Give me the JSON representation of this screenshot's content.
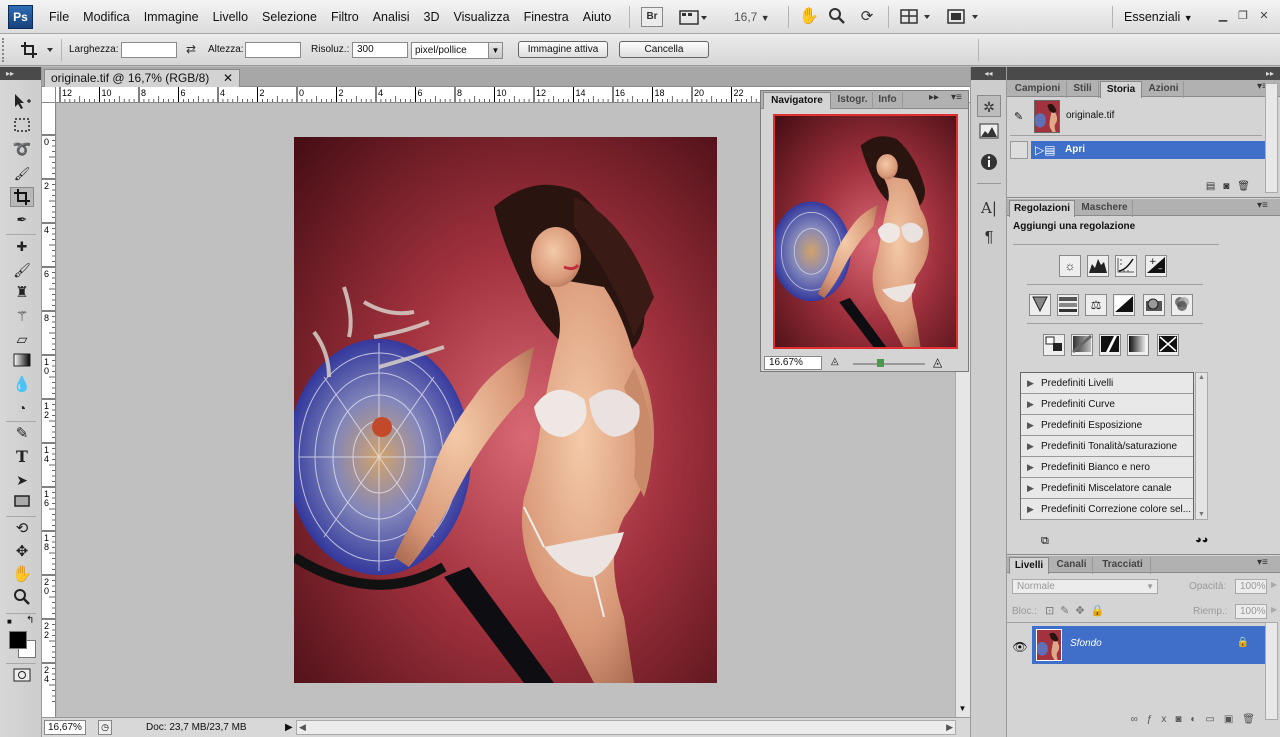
{
  "menubar": {
    "logo": "Ps",
    "items": [
      "File",
      "Modifica",
      "Immagine",
      "Livello",
      "Selezione",
      "Filtro",
      "Analisi",
      "3D",
      "Visualizza",
      "Finestra",
      "Aiuto"
    ],
    "bridge_label": "Br",
    "zoom_value": "16,7",
    "workspace": "Essenziali"
  },
  "options": {
    "width_label": "Larghezza:",
    "width_value": "",
    "height_label": "Altezza:",
    "height_value": "",
    "resolution_label": "Risoluz.:",
    "resolution_value": "300",
    "unit_value": "pixel/pollice",
    "front_image_label": "Immagine attiva",
    "clear_label": "Cancella"
  },
  "document": {
    "tab_title": "originale.tif @ 16,7% (RGB/8)",
    "ruler_h_labels": [
      "12",
      "10",
      "8",
      "6",
      "4",
      "2",
      "0",
      "2",
      "4",
      "6",
      "8",
      "10",
      "12",
      "14",
      "16",
      "18",
      "20",
      "22"
    ],
    "ruler_v_labels": [
      "0",
      "2",
      "4",
      "6",
      "8",
      "1\n0",
      "1\n2",
      "1\n4",
      "1\n6",
      "1\n8",
      "2\n0",
      "2\n2",
      "2\n4"
    ],
    "status_zoom": "16,67%",
    "status_doc": "Doc: 23,7 MB/23,7 MB"
  },
  "navigator": {
    "tabs": [
      "Navigatore",
      "Istogr.",
      "Info"
    ],
    "zoom_value": "16.67%"
  },
  "history_panel": {
    "tabs": [
      "Campioni",
      "Stili",
      "Storia",
      "Azioni"
    ],
    "snapshot_name": "originale.tif",
    "history_item": "Apri"
  },
  "adjustments_panel": {
    "tabs": [
      "Regolazioni",
      "Maschere"
    ],
    "heading": "Aggiungi una regolazione",
    "presets": [
      "Predefiniti Livelli",
      "Predefiniti Curve",
      "Predefiniti Esposizione",
      "Predefiniti Tonalità/saturazione",
      "Predefiniti Bianco e nero",
      "Predefiniti Miscelatore canale",
      "Predefiniti Correzione colore sel..."
    ]
  },
  "layers_panel": {
    "tabs": [
      "Livelli",
      "Canali",
      "Tracciati"
    ],
    "blend_mode": "Normale",
    "opacity_label": "Opacità:",
    "opacity_value": "100%",
    "lock_label": "Bloc.:",
    "fill_label": "Riemp.:",
    "fill_value": "100%",
    "layer_name": "Sfondo"
  },
  "colors": {
    "accent_selection": "#3f6fc8",
    "navigator_frame": "#e03030"
  }
}
